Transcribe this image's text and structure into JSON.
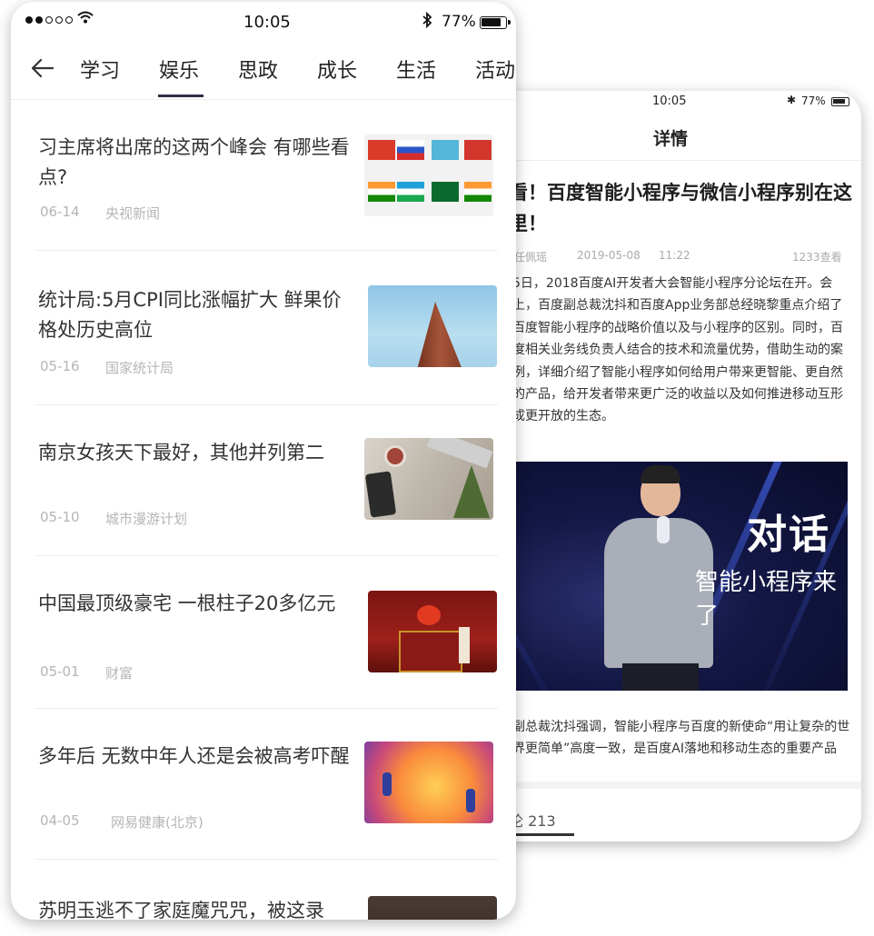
{
  "front": {
    "status": {
      "time": "10:05",
      "battery": "77%",
      "bluetooth_glyph": "✱",
      "wifi_glyph": "◠"
    },
    "tabs": [
      "学习",
      "娱乐",
      "思政",
      "成长",
      "生活",
      "活动"
    ],
    "active_tab_index": 1,
    "news": [
      {
        "title": "习主席将出席的这两个峰会 有哪些看点?",
        "date": "06-14",
        "source": "央视新闻",
        "thumb": "flags-thumb"
      },
      {
        "title": "统计局:5月CPI同比涨幅扩大 鲜果价格处历史高位",
        "date": "05-16",
        "source": "国家统计局",
        "thumb": "building-thumb"
      },
      {
        "title": "南京女孩天下最好，其他并列第二",
        "date": "05-10",
        "source": "城市漫游计划",
        "thumb": "desk-thumb"
      },
      {
        "title": "中国最顶级豪宅 一根柱子20多亿元",
        "date": "05-01",
        "source": "财富",
        "thumb": "gate-thumb"
      },
      {
        "title": "多年后 无数中年人还是会被高考吓醒",
        "date": "04-05",
        "source": "网易健康(北京)",
        "thumb": "illustration-thumb"
      },
      {
        "title": "苏明玉逃不了家庭魔咒咒，被这录",
        "date": "",
        "source": "",
        "thumb": "dark-thumb"
      }
    ]
  },
  "back": {
    "status": {
      "time": "10:05",
      "battery": "77%"
    },
    "nav_title": "详情",
    "article": {
      "title": "看！百度智能小程序与微信小程序别在这里！",
      "author": "任佩瑶",
      "date": "2019-05-08",
      "time": "11:22",
      "views": "1233查看",
      "body": "5日，2018百度AI开发者大会智能小程序分论坛在开。会上，百度副总裁沈抖和百度App业务部总经晓黎重点介绍了百度智能小程序的战略价值以及与小程序的区别。同时，百度相关业务线负责人结合的技术和流量优势，借助生动的案例，详细介绍了智能小程序如何给用户带来更智能、更自然的产品，给开发者带来更广泛的收益以及如何推进移动互形成更开放的生态。",
      "image_text_big": "对话",
      "image_text_sub": "智能小程序来了",
      "body2": "副总裁沈抖强调，智能小程序与百度的新使命“用让复杂的世界更简单”高度一致，是百度AI落地和移动生态的重要产品",
      "comment_label": "论 213"
    }
  }
}
